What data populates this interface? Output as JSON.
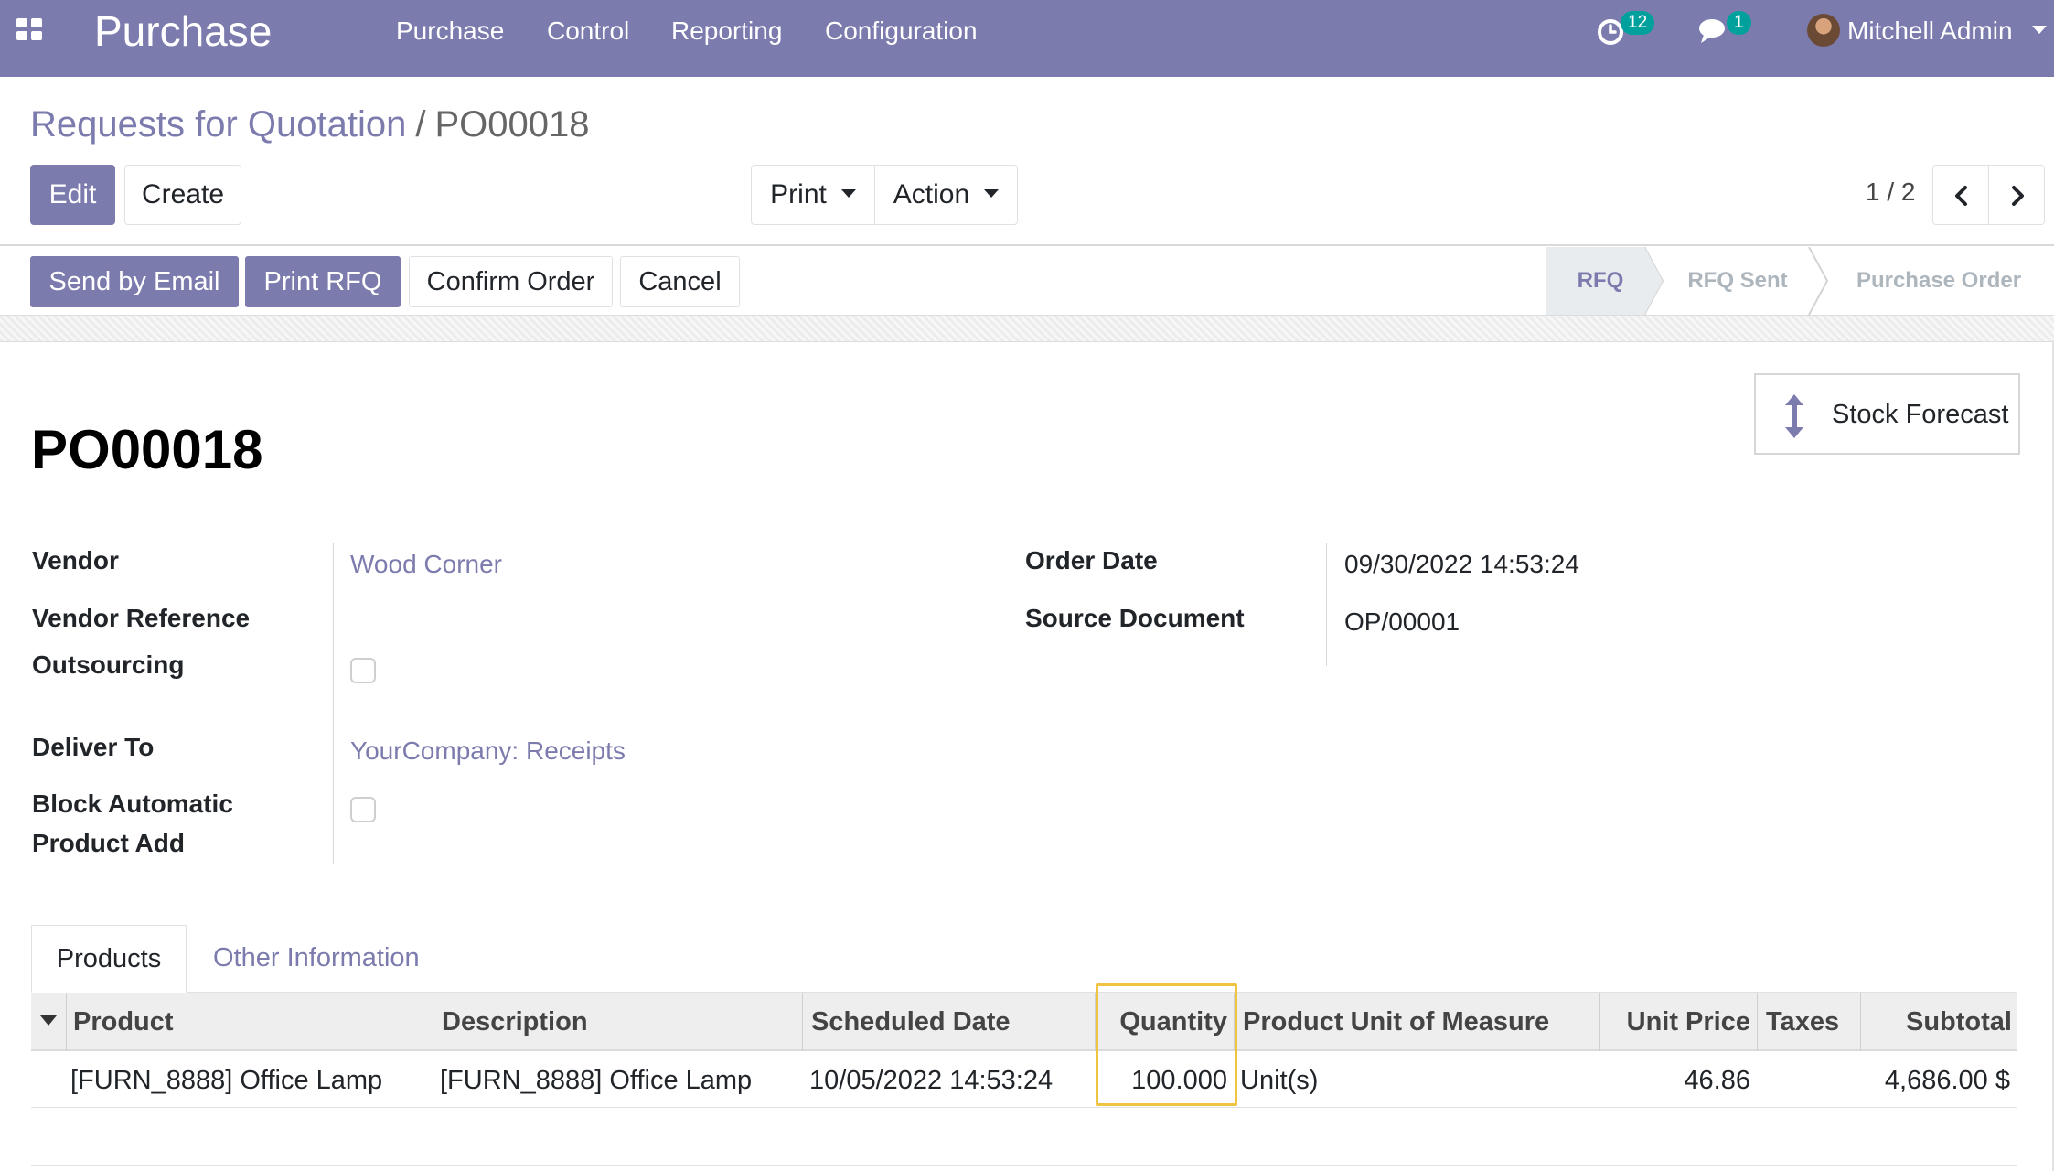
{
  "navbar": {
    "app_name": "Purchase",
    "menus": [
      "Purchase",
      "Control",
      "Reporting",
      "Configuration"
    ],
    "activity_count": "12",
    "message_count": "1",
    "user_name": "Mitchell Admin",
    "color": "#7c7bad"
  },
  "breadcrumb": {
    "parent": "Requests for Quotation",
    "separator": "/",
    "current": "PO00018"
  },
  "control_panel": {
    "edit_label": "Edit",
    "create_label": "Create",
    "print_label": "Print",
    "action_label": "Action",
    "pager_value": "1 / 2"
  },
  "statusbar": {
    "buttons": [
      "Send by Email",
      "Print RFQ",
      "Confirm Order",
      "Cancel"
    ],
    "stages": [
      "RFQ",
      "RFQ Sent",
      "Purchase Order"
    ],
    "active_stage": "RFQ"
  },
  "form": {
    "stock_forecast_label": "Stock Forecast",
    "title": "PO00018",
    "left_fields": {
      "vendor_label": "Vendor",
      "vendor_value": "Wood Corner",
      "vendor_reference_label": "Vendor Reference",
      "vendor_reference_value": "",
      "outsourcing_label": "Outsourcing",
      "outsourcing_checked": false,
      "deliver_to_label": "Deliver To",
      "deliver_to_value": "YourCompany: Receipts",
      "block_label_line1": "Block Automatic",
      "block_label_line2": "Product Add",
      "block_checked": false
    },
    "right_fields": {
      "order_date_label": "Order Date",
      "order_date_value": "09/30/2022 14:53:24",
      "source_document_label": "Source Document",
      "source_document_value": "OP/00001"
    }
  },
  "notebook": {
    "tabs": [
      "Products",
      "Other Information"
    ],
    "active_tab": "Products"
  },
  "order_lines": {
    "columns": [
      "Product",
      "Description",
      "Scheduled Date",
      "Quantity",
      "Product Unit of Measure",
      "Unit Price",
      "Taxes",
      "Subtotal"
    ],
    "rows": [
      {
        "product": "[FURN_8888] Office Lamp",
        "description": "[FURN_8888] Office Lamp",
        "scheduled_date": "10/05/2022 14:53:24",
        "quantity": "100.000",
        "uom": "Unit(s)",
        "unit_price": "46.86",
        "taxes": "",
        "subtotal": "4,686.00 $"
      }
    ],
    "highlight_color": "#f0c343"
  }
}
